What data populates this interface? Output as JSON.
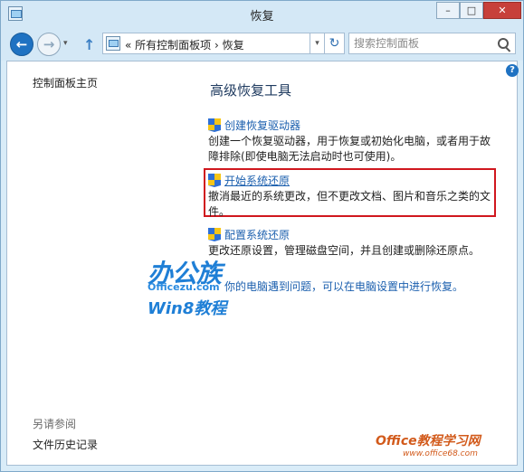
{
  "window": {
    "title": "恢复",
    "minimize_symbol": "–",
    "maximize_symbol": "□",
    "close_symbol": "✕"
  },
  "nav": {
    "back_symbol": "←",
    "forward_symbol": "→",
    "dropdown_symbol": "▾",
    "up_symbol": "↑",
    "address_path": "« 所有控制面板项 › 恢复",
    "address_dropdown_symbol": "▾",
    "refresh_symbol": "↻",
    "search_placeholder": "搜索控制面板"
  },
  "left_pane": {
    "home_link": "控制面板主页",
    "see_also_label": "另请参阅",
    "file_history_link": "文件历史记录"
  },
  "help_symbol": "?",
  "main": {
    "heading": "高级恢复工具",
    "tools": [
      {
        "title": "创建恢复驱动器",
        "description": "创建一个恢复驱动器，用于恢复或初始化电脑，或者用于故障排除(即使电脑无法启动时也可使用)。"
      },
      {
        "title": "开始系统还原",
        "description": "撤消最近的系统更改，但不更改文档、图片和音乐之类的文件。"
      },
      {
        "title": "配置系统还原",
        "description": "更改还原设置，管理磁盘空间，并且创建或删除还原点。"
      }
    ],
    "bottom_link": "你的电脑遇到问题，可以在电脑设置中进行恢复。"
  },
  "watermarks": {
    "brand_large": "办公族",
    "brand_url": "Officezu.com",
    "brand_sub": "Win8教程",
    "site_name": "Office教程学习网",
    "site_url": "www.office68.com"
  },
  "colors": {
    "link": "#1b5fae",
    "highlight_border": "#d0171e",
    "chrome": "#d4e8f6"
  }
}
